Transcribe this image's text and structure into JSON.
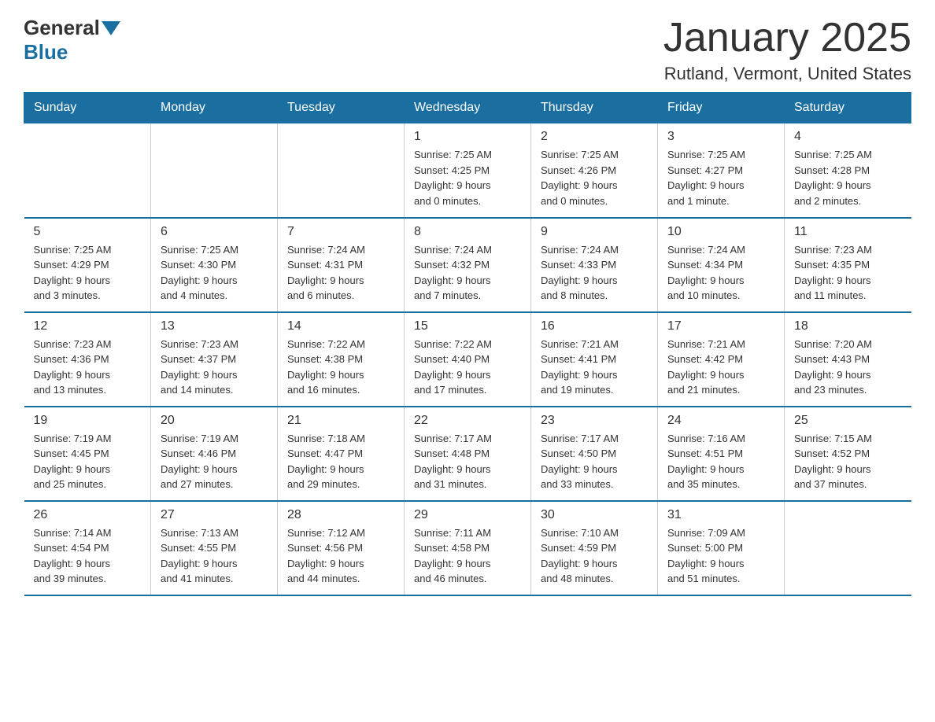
{
  "logo": {
    "general": "General",
    "blue": "Blue"
  },
  "title": "January 2025",
  "location": "Rutland, Vermont, United States",
  "days_of_week": [
    "Sunday",
    "Monday",
    "Tuesday",
    "Wednesday",
    "Thursday",
    "Friday",
    "Saturday"
  ],
  "weeks": [
    [
      {
        "day": "",
        "info": ""
      },
      {
        "day": "",
        "info": ""
      },
      {
        "day": "",
        "info": ""
      },
      {
        "day": "1",
        "info": "Sunrise: 7:25 AM\nSunset: 4:25 PM\nDaylight: 9 hours\nand 0 minutes."
      },
      {
        "day": "2",
        "info": "Sunrise: 7:25 AM\nSunset: 4:26 PM\nDaylight: 9 hours\nand 0 minutes."
      },
      {
        "day": "3",
        "info": "Sunrise: 7:25 AM\nSunset: 4:27 PM\nDaylight: 9 hours\nand 1 minute."
      },
      {
        "day": "4",
        "info": "Sunrise: 7:25 AM\nSunset: 4:28 PM\nDaylight: 9 hours\nand 2 minutes."
      }
    ],
    [
      {
        "day": "5",
        "info": "Sunrise: 7:25 AM\nSunset: 4:29 PM\nDaylight: 9 hours\nand 3 minutes."
      },
      {
        "day": "6",
        "info": "Sunrise: 7:25 AM\nSunset: 4:30 PM\nDaylight: 9 hours\nand 4 minutes."
      },
      {
        "day": "7",
        "info": "Sunrise: 7:24 AM\nSunset: 4:31 PM\nDaylight: 9 hours\nand 6 minutes."
      },
      {
        "day": "8",
        "info": "Sunrise: 7:24 AM\nSunset: 4:32 PM\nDaylight: 9 hours\nand 7 minutes."
      },
      {
        "day": "9",
        "info": "Sunrise: 7:24 AM\nSunset: 4:33 PM\nDaylight: 9 hours\nand 8 minutes."
      },
      {
        "day": "10",
        "info": "Sunrise: 7:24 AM\nSunset: 4:34 PM\nDaylight: 9 hours\nand 10 minutes."
      },
      {
        "day": "11",
        "info": "Sunrise: 7:23 AM\nSunset: 4:35 PM\nDaylight: 9 hours\nand 11 minutes."
      }
    ],
    [
      {
        "day": "12",
        "info": "Sunrise: 7:23 AM\nSunset: 4:36 PM\nDaylight: 9 hours\nand 13 minutes."
      },
      {
        "day": "13",
        "info": "Sunrise: 7:23 AM\nSunset: 4:37 PM\nDaylight: 9 hours\nand 14 minutes."
      },
      {
        "day": "14",
        "info": "Sunrise: 7:22 AM\nSunset: 4:38 PM\nDaylight: 9 hours\nand 16 minutes."
      },
      {
        "day": "15",
        "info": "Sunrise: 7:22 AM\nSunset: 4:40 PM\nDaylight: 9 hours\nand 17 minutes."
      },
      {
        "day": "16",
        "info": "Sunrise: 7:21 AM\nSunset: 4:41 PM\nDaylight: 9 hours\nand 19 minutes."
      },
      {
        "day": "17",
        "info": "Sunrise: 7:21 AM\nSunset: 4:42 PM\nDaylight: 9 hours\nand 21 minutes."
      },
      {
        "day": "18",
        "info": "Sunrise: 7:20 AM\nSunset: 4:43 PM\nDaylight: 9 hours\nand 23 minutes."
      }
    ],
    [
      {
        "day": "19",
        "info": "Sunrise: 7:19 AM\nSunset: 4:45 PM\nDaylight: 9 hours\nand 25 minutes."
      },
      {
        "day": "20",
        "info": "Sunrise: 7:19 AM\nSunset: 4:46 PM\nDaylight: 9 hours\nand 27 minutes."
      },
      {
        "day": "21",
        "info": "Sunrise: 7:18 AM\nSunset: 4:47 PM\nDaylight: 9 hours\nand 29 minutes."
      },
      {
        "day": "22",
        "info": "Sunrise: 7:17 AM\nSunset: 4:48 PM\nDaylight: 9 hours\nand 31 minutes."
      },
      {
        "day": "23",
        "info": "Sunrise: 7:17 AM\nSunset: 4:50 PM\nDaylight: 9 hours\nand 33 minutes."
      },
      {
        "day": "24",
        "info": "Sunrise: 7:16 AM\nSunset: 4:51 PM\nDaylight: 9 hours\nand 35 minutes."
      },
      {
        "day": "25",
        "info": "Sunrise: 7:15 AM\nSunset: 4:52 PM\nDaylight: 9 hours\nand 37 minutes."
      }
    ],
    [
      {
        "day": "26",
        "info": "Sunrise: 7:14 AM\nSunset: 4:54 PM\nDaylight: 9 hours\nand 39 minutes."
      },
      {
        "day": "27",
        "info": "Sunrise: 7:13 AM\nSunset: 4:55 PM\nDaylight: 9 hours\nand 41 minutes."
      },
      {
        "day": "28",
        "info": "Sunrise: 7:12 AM\nSunset: 4:56 PM\nDaylight: 9 hours\nand 44 minutes."
      },
      {
        "day": "29",
        "info": "Sunrise: 7:11 AM\nSunset: 4:58 PM\nDaylight: 9 hours\nand 46 minutes."
      },
      {
        "day": "30",
        "info": "Sunrise: 7:10 AM\nSunset: 4:59 PM\nDaylight: 9 hours\nand 48 minutes."
      },
      {
        "day": "31",
        "info": "Sunrise: 7:09 AM\nSunset: 5:00 PM\nDaylight: 9 hours\nand 51 minutes."
      },
      {
        "day": "",
        "info": ""
      }
    ]
  ]
}
